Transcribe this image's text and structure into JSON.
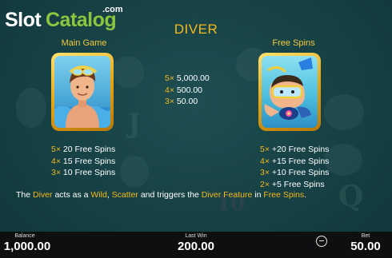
{
  "logo": {
    "part1": "Slot",
    "part2": "Catalog",
    "suffix": ".com"
  },
  "title": "DIVER",
  "main_game": {
    "label": "Main Game",
    "rows": [
      {
        "mult": "5×",
        "text": " 20 Free Spins"
      },
      {
        "mult": "4×",
        "text": " 15 Free Spins"
      },
      {
        "mult": "3×",
        "text": " 10 Free Spins"
      }
    ]
  },
  "payouts": {
    "rows": [
      {
        "mult": "5×",
        "text": " 5,000.00"
      },
      {
        "mult": "4×",
        "text": " 500.00"
      },
      {
        "mult": "3×",
        "text": " 50.00"
      }
    ]
  },
  "free_spins": {
    "label": "Free Spins",
    "rows": [
      {
        "mult": "5×",
        "text": " +20 Free Spins"
      },
      {
        "mult": "4×",
        "text": " +15 Free Spins"
      },
      {
        "mult": "3×",
        "text": " +10 Free Spins"
      },
      {
        "mult": "2×",
        "text": " +5 Free Spins"
      }
    ]
  },
  "description": {
    "t1": "The ",
    "h1": "Diver",
    "t2": " acts as a ",
    "h2": "Wild",
    "t3": ", ",
    "h3": "Scatter",
    "t4": " and triggers the ",
    "h4": "Diver Feature",
    "t5": " in ",
    "h5": "Free Spins",
    "t6": "."
  },
  "bottom_bar": {
    "balance_label": "Balance",
    "balance_value": "1,000.00",
    "last_win_label": "Last Win",
    "last_win_value": "200.00",
    "bet_label": "Bet",
    "bet_value": "50.00"
  },
  "colors": {
    "accent": "#f5b81d",
    "logo_green": "#8cc63f",
    "background": "#2a6467",
    "bar": "#0e0f10"
  },
  "icons": {
    "decrease_bet": "minus-circle-icon"
  }
}
